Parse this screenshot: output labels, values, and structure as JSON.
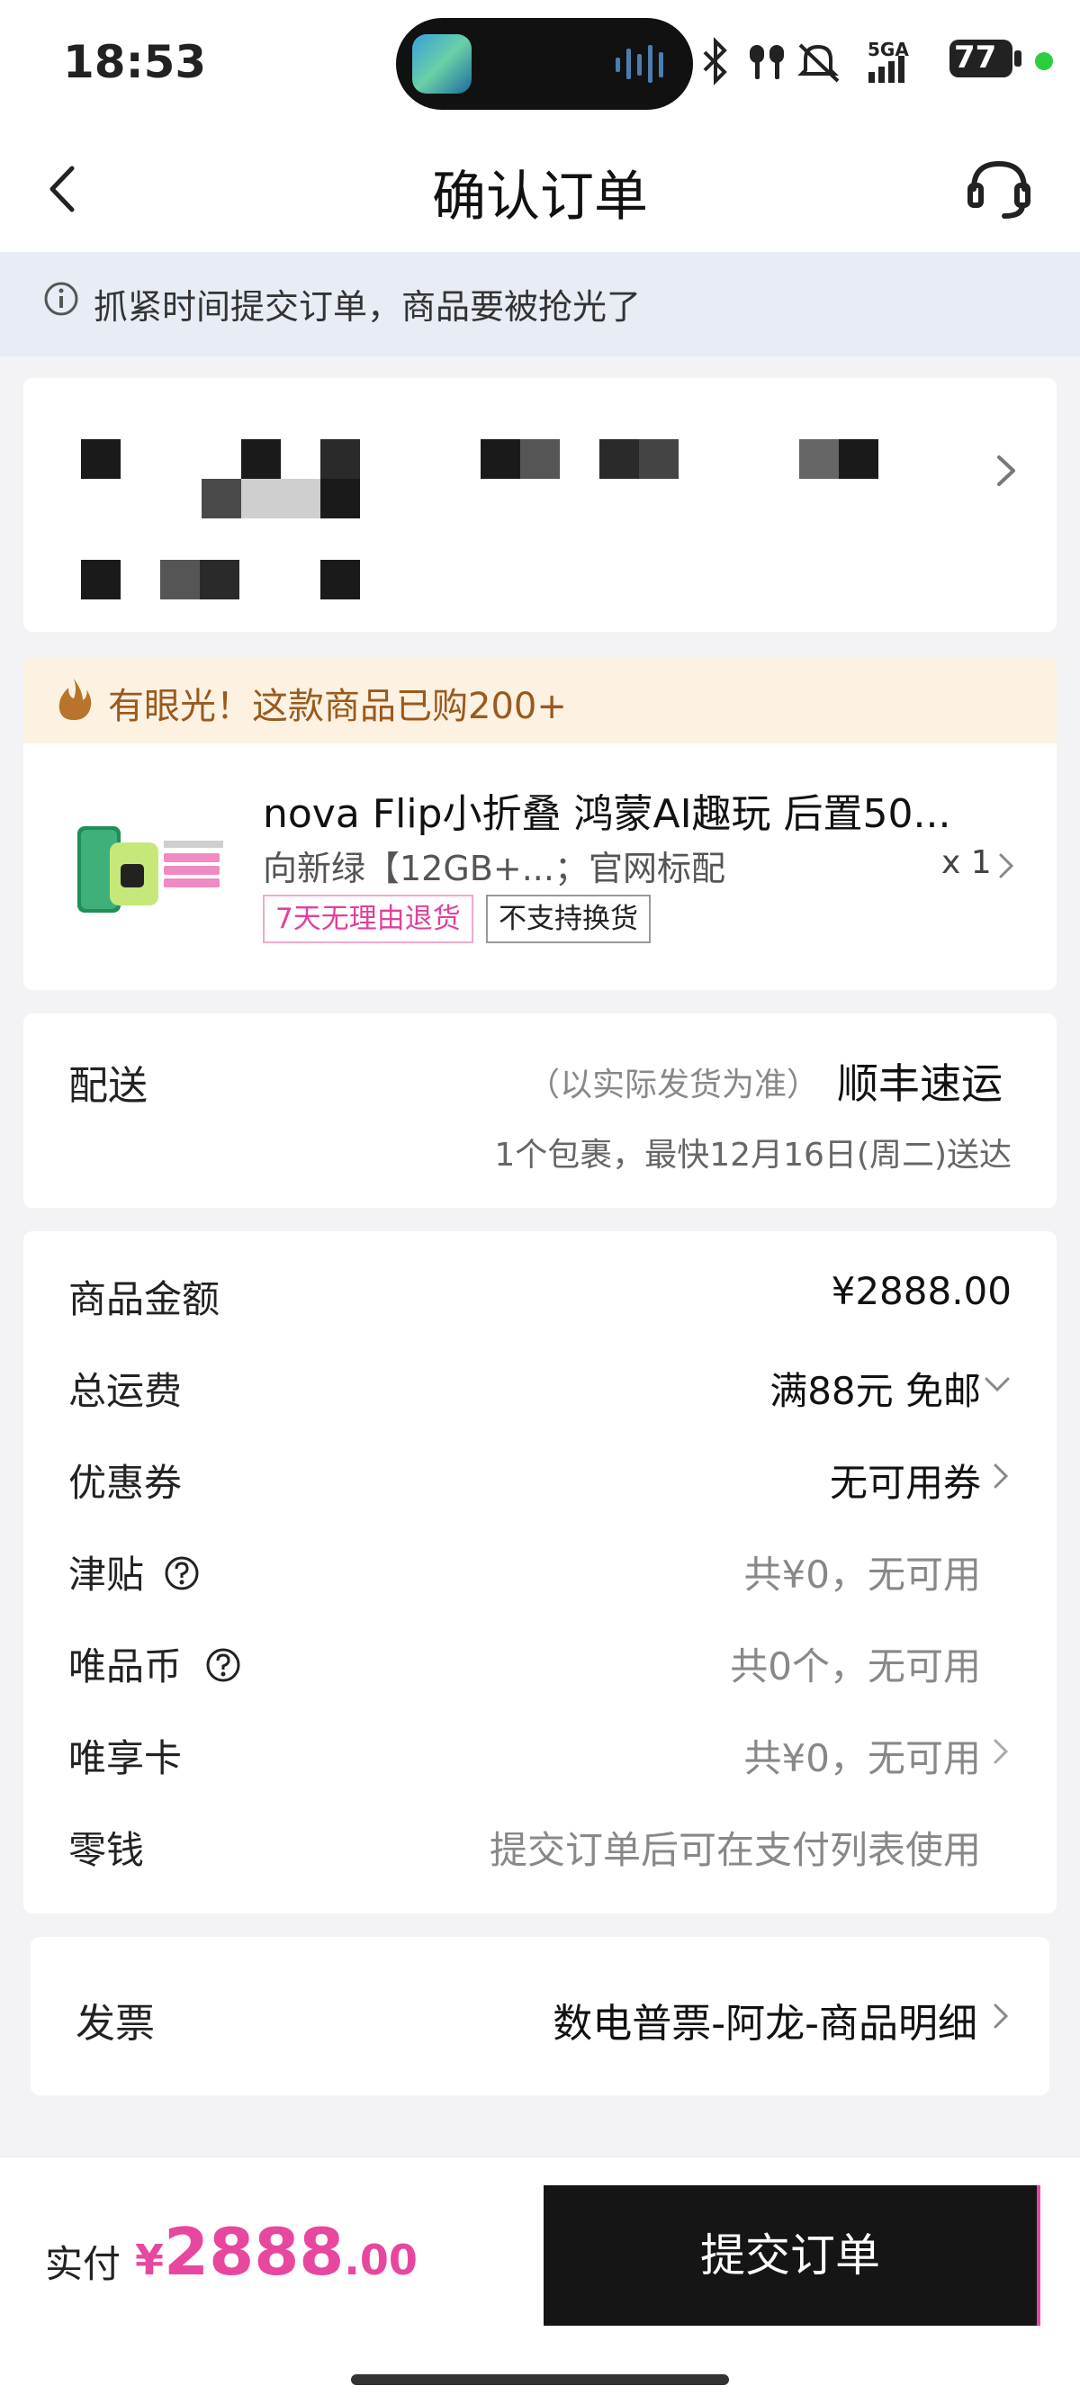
{
  "status_bar": {
    "time": "18:53",
    "network": "5GA",
    "battery": "77",
    "icons": [
      "bluetooth-icon",
      "earbuds-icon",
      "mute-icon",
      "signal-icon",
      "battery-icon"
    ]
  },
  "header": {
    "title": "确认订单",
    "back_icon": "chevron-left-icon",
    "service_icon": "headset-icon"
  },
  "notice": {
    "text": "抓紧时间提交订单，商品要被抢光了",
    "icon": "info-icon"
  },
  "banner": {
    "text": "有眼光！这款商品已购200+",
    "icon": "fire-icon"
  },
  "product": {
    "name": "nova Flip小折叠 鸿蒙AI趣玩 后置50...",
    "spec": "向新绿【12GB+...；官网标配",
    "quantity": "x 1",
    "tags": [
      "7天无理由退货",
      "不支持换货"
    ]
  },
  "delivery": {
    "label": "配送",
    "note": "（以实际发货为准）",
    "carrier": "顺丰速运",
    "eta": "1个包裹，最快12月16日(周二)送达"
  },
  "price_rows": [
    {
      "label": "商品金额",
      "value": "¥2888.00"
    },
    {
      "label": "总运费",
      "value": "满88元 免邮"
    },
    {
      "label": "优惠券",
      "value": "无可用券"
    },
    {
      "label": "津贴",
      "value": "共¥0，无可用"
    },
    {
      "label": "唯品币",
      "value": "共0个，无可用"
    },
    {
      "label": "唯享卡",
      "value": "共¥0，无可用"
    },
    {
      "label": "零钱",
      "value": "提交订单后可在支付列表使用"
    }
  ],
  "invoice": {
    "label": "发票",
    "value": "数电普票-阿龙-商品明细"
  },
  "bottom": {
    "pay_label": "实付",
    "currency": "¥",
    "amount_int": "2888",
    "amount_dec": ".00",
    "submit_label": "提交订单"
  },
  "colors": {
    "accent": "#e8479f",
    "button": "#151515",
    "notice_bg": "#e7ecf5",
    "banner_bg": "#fdf1e2"
  }
}
